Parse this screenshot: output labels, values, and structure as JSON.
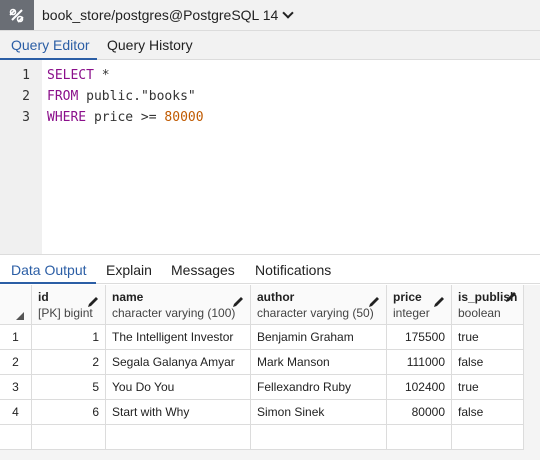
{
  "connection": {
    "title": "book_store/postgres@PostgreSQL 14",
    "icon": "connection-icon"
  },
  "editor_tabs": [
    "Query Editor",
    "Query History"
  ],
  "editor": {
    "line_numbers": [
      "1",
      "2",
      "3"
    ],
    "lines": [
      {
        "kw": "SELECT",
        "rest": " *"
      },
      {
        "kw": "FROM",
        "rest": " public.",
        "str": "\"books\""
      },
      {
        "kw": "WHERE",
        "rest": " price >= ",
        "num": "80000"
      }
    ]
  },
  "output_tabs": [
    "Data Output",
    "Explain",
    "Messages",
    "Notifications"
  ],
  "grid": {
    "columns": [
      {
        "name": "id",
        "type": "[PK] bigint"
      },
      {
        "name": "name",
        "type": "character varying (100)"
      },
      {
        "name": "author",
        "type": "character varying (50)"
      },
      {
        "name": "price",
        "type": "integer"
      },
      {
        "name": "is_publish",
        "type": "boolean"
      }
    ],
    "rows": [
      {
        "n": "1",
        "id": "1",
        "name": "The Intelligent Investor",
        "author": "Benjamin Graham",
        "price": "175500",
        "is_publish": "true"
      },
      {
        "n": "2",
        "id": "2",
        "name": "Segala Galanya Amyar",
        "author": "Mark Manson",
        "price": "111000",
        "is_publish": "false"
      },
      {
        "n": "3",
        "id": "5",
        "name": "You Do You",
        "author": "Fellexandro Ruby",
        "price": "102400",
        "is_publish": "true"
      },
      {
        "n": "4",
        "id": "6",
        "name": "Start with Why",
        "author": "Simon Sinek",
        "price": "80000",
        "is_publish": "false"
      }
    ]
  },
  "colors": {
    "accent": "#2b5ea5",
    "keyword": "#8b0f8b",
    "number": "#c05a00",
    "icon_bg": "#6a6e75"
  }
}
